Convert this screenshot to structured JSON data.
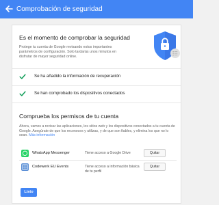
{
  "appbar": {
    "title": "Comprobación de seguridad"
  },
  "intro": {
    "heading": "Es el momento de comprobar la seguridad",
    "text": "Protege tu cuenta de Google revisando estos importantes parámetros de configuración. Solo tardarás unos minutos en disfrutar de mayor seguridad online."
  },
  "checks": [
    {
      "label": "Se ha añadido la información de recuperación"
    },
    {
      "label": "Se han comprobado los dispositivos conectados"
    }
  ],
  "permissions": {
    "heading": "Comprueba los permisos de tu cuenta",
    "description": "Ahora, vamos a revisar las aplicaciones, los sitios web y los dispositivos conectados a tu cuenta de Google. Asegúrate de que los reconoces y utilizas, y de que son fiables, y elimina los que no lo sean.",
    "more_info": "Más información",
    "apps": [
      {
        "name": "WhatsApp Messenger",
        "access": "Tiene acceso a Google Drive",
        "remove_label": "Quitar",
        "icon": "whatsapp-icon",
        "icon_color": "#25d366"
      },
      {
        "name": "Codewerk EU Events",
        "access": "Tiene acceso a información básica de tu perfil",
        "remove_label": "Quitar",
        "icon": "codewerk-icon",
        "icon_color": "#5b8fd6"
      }
    ]
  },
  "footer": {
    "done_label": "Listo"
  },
  "colors": {
    "accent": "#4285f4",
    "check": "#0f9d58"
  }
}
